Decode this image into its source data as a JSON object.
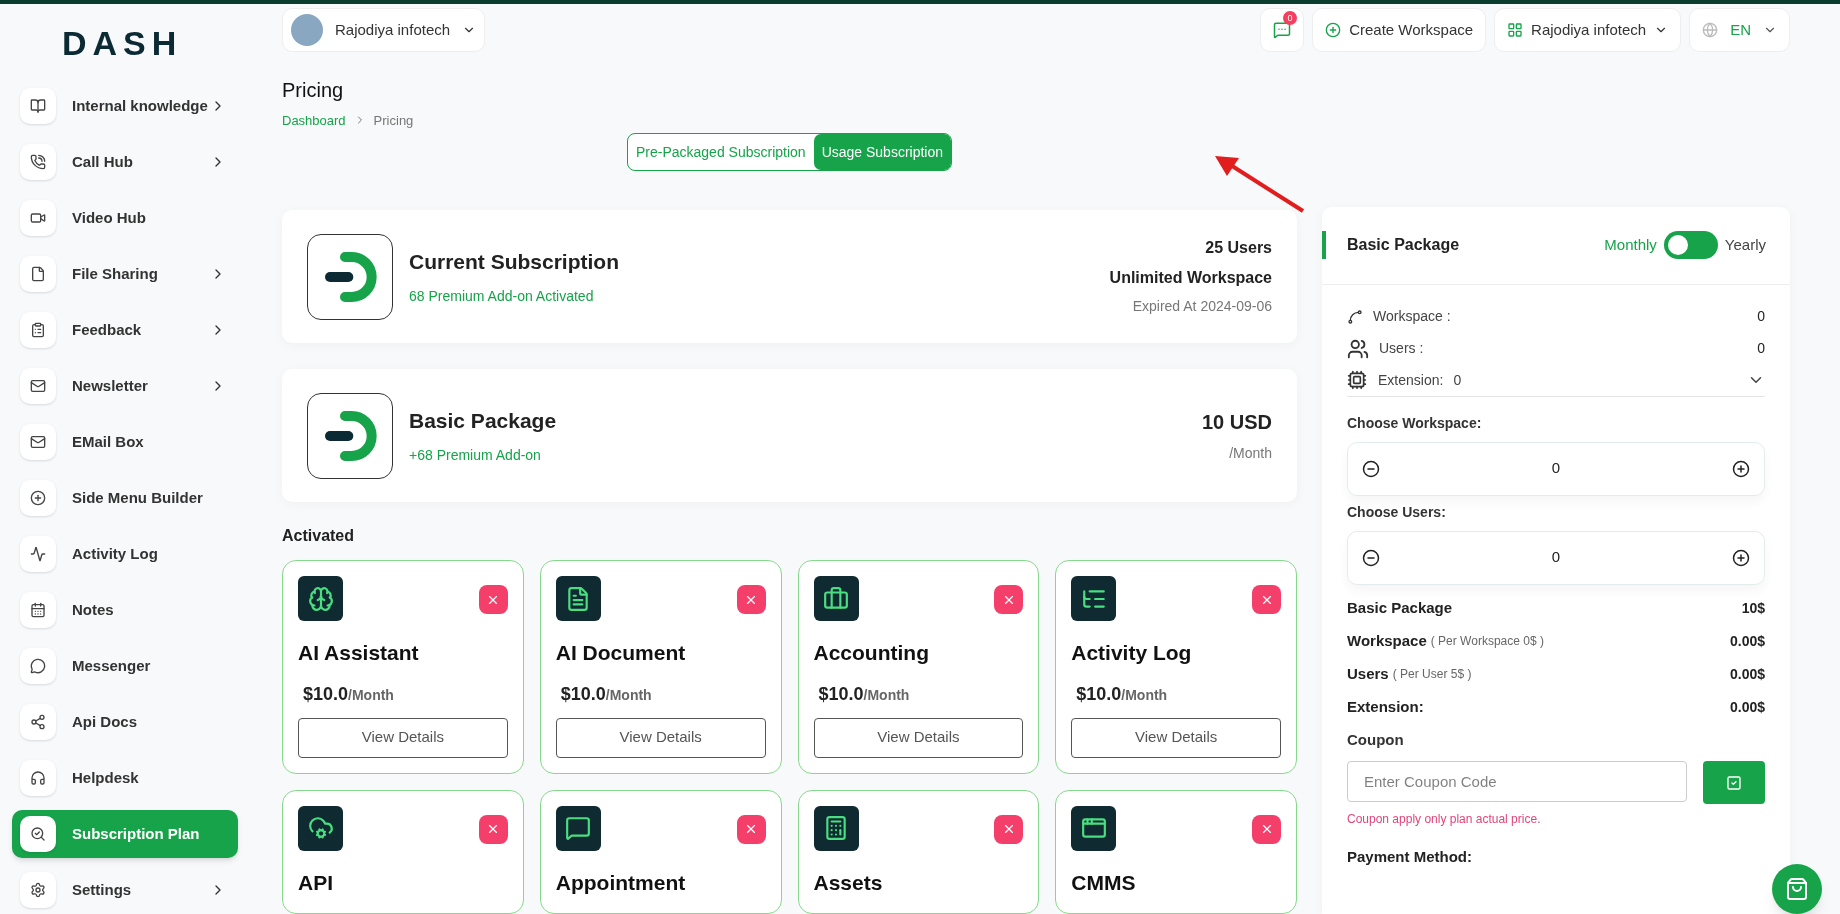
{
  "logo": "DASH",
  "sidebar": {
    "items": [
      {
        "label": "Internal knowledge",
        "has_submenu": true,
        "selected": false
      },
      {
        "label": "Call Hub",
        "has_submenu": true,
        "selected": false
      },
      {
        "label": "Video Hub",
        "has_submenu": false,
        "selected": false
      },
      {
        "label": "File Sharing",
        "has_submenu": true,
        "selected": false
      },
      {
        "label": "Feedback",
        "has_submenu": true,
        "selected": false
      },
      {
        "label": "Newsletter",
        "has_submenu": true,
        "selected": false
      },
      {
        "label": "EMail Box",
        "has_submenu": false,
        "selected": false
      },
      {
        "label": "Side Menu Builder",
        "has_submenu": false,
        "selected": false
      },
      {
        "label": "Activity Log",
        "has_submenu": false,
        "selected": false
      },
      {
        "label": "Notes",
        "has_submenu": false,
        "selected": false
      },
      {
        "label": "Messenger",
        "has_submenu": false,
        "selected": false
      },
      {
        "label": "Api Docs",
        "has_submenu": false,
        "selected": false
      },
      {
        "label": "Helpdesk",
        "has_submenu": false,
        "selected": false
      },
      {
        "label": "Subscription Plan",
        "has_submenu": false,
        "selected": true
      },
      {
        "label": "Settings",
        "has_submenu": true,
        "selected": false
      }
    ]
  },
  "topbar": {
    "company": "Rajodiya infotech",
    "notifications": "0",
    "create_workspace": "Create Workspace",
    "workspace": "Rajodiya infotech",
    "language": "EN"
  },
  "page": {
    "title": "Pricing",
    "breadcrumb": [
      "Dashboard",
      "Pricing"
    ]
  },
  "subscription_tabs": [
    {
      "label": "Pre-Packaged Subscription",
      "selected": false
    },
    {
      "label": "Usage Subscription",
      "selected": true
    }
  ],
  "current_subscription": {
    "title": "Current Subscription",
    "subtitle": "68 Premium Add-on Activated",
    "users": "25 Users",
    "workspace": "Unlimited Workspace",
    "expiry": "Expired At 2024-09-06"
  },
  "package": {
    "title": "Basic Package",
    "subtitle": "+68 Premium Add-on",
    "price": "10 USD",
    "period": "/Month"
  },
  "activated": {
    "heading": "Activated",
    "addons": [
      {
        "name": "AI Assistant",
        "price": "$10.0",
        "period": "/Month",
        "button": "View Details"
      },
      {
        "name": "AI Document",
        "price": "$10.0",
        "period": "/Month",
        "button": "View Details"
      },
      {
        "name": "Accounting",
        "price": "$10.0",
        "period": "/Month",
        "button": "View Details"
      },
      {
        "name": "Activity Log",
        "price": "$10.0",
        "period": "/Month",
        "button": "View Details"
      },
      {
        "name": "API"
      },
      {
        "name": "Appointment"
      },
      {
        "name": "Assets"
      },
      {
        "name": "CMMS"
      }
    ]
  },
  "summary": {
    "title": "Basic Package",
    "monthly": "Monthly",
    "yearly_label": "Yearly",
    "yearly": false,
    "counts": [
      {
        "label": "Workspace :",
        "value": "0"
      },
      {
        "label": "Users :",
        "value": "0"
      }
    ],
    "extension": {
      "label": "Extension:",
      "value": "0"
    },
    "choosers": [
      {
        "label": "Choose Workspace:",
        "value": "0"
      },
      {
        "label": "Choose Users:",
        "value": "0"
      }
    ],
    "lines": [
      {
        "label": "Basic Package",
        "value": "10$"
      },
      {
        "label": "Workspace",
        "note": "( Per Workspace 0$ )",
        "value": "0.00$"
      },
      {
        "label": "Users",
        "note": "( Per User 5$ )",
        "value": "0.00$"
      },
      {
        "label": "Extension:",
        "value": "0.00$"
      }
    ],
    "coupon_label": "Coupon",
    "coupon_placeholder": "Enter Coupon Code",
    "coupon_hint": "Coupon apply only plan actual price.",
    "payment_label": "Payment Method:"
  }
}
